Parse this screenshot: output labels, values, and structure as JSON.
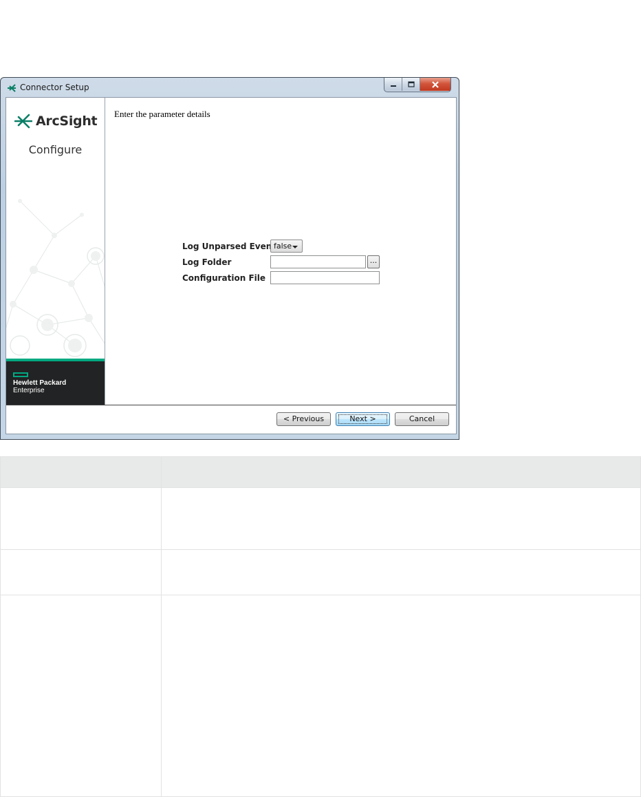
{
  "window": {
    "title": "Connector Setup",
    "controls": {
      "minimize": "minimize",
      "maximize": "maximize",
      "close": "close"
    }
  },
  "sidebar": {
    "brand": "ArcSight",
    "step": "Configure",
    "vendor_line1": "Hewlett Packard",
    "vendor_line2": "Enterprise",
    "accent_color": "#01a982"
  },
  "main": {
    "heading": "Enter the parameter details",
    "fields": {
      "log_unparsed": {
        "label": "Log Unparsed Events?",
        "value": "false"
      },
      "log_folder": {
        "label": "Log Folder",
        "value": "",
        "browse_label": "..."
      },
      "config_file": {
        "label": "Configuration File",
        "value": ""
      }
    }
  },
  "buttons": {
    "previous": "< Previous",
    "next": "Next >",
    "cancel": "Cancel"
  },
  "doc_table": {
    "headers": [
      "",
      ""
    ],
    "rows": [
      [
        "",
        ""
      ],
      [
        "",
        ""
      ],
      [
        "",
        ""
      ]
    ]
  }
}
